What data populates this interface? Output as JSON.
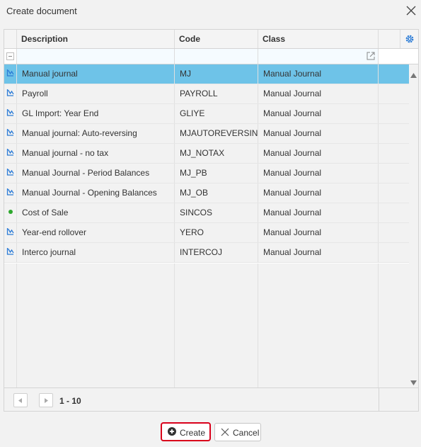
{
  "dialog": {
    "title": "Create document"
  },
  "grid": {
    "columns": [
      "Description",
      "Code",
      "Class"
    ],
    "rows": [
      {
        "icon": "chart-line-icon",
        "description": "Manual journal",
        "code": "MJ",
        "class": "Manual Journal",
        "selected": true
      },
      {
        "icon": "chart-line-icon",
        "description": "Payroll",
        "code": "PAYROLL",
        "class": "Manual Journal"
      },
      {
        "icon": "chart-line-icon",
        "description": "GL Import: Year End",
        "code": "GLIYE",
        "class": "Manual Journal"
      },
      {
        "icon": "chart-line-icon",
        "description": "Manual journal: Auto-reversing",
        "code": "MJAUTOREVERSING",
        "class": "Manual Journal"
      },
      {
        "icon": "chart-line-icon",
        "description": "Manual journal - no tax",
        "code": "MJ_NOTAX",
        "class": "Manual Journal"
      },
      {
        "icon": "chart-line-icon",
        "description": "Manual Journal - Period Balances",
        "code": "MJ_PB",
        "class": "Manual Journal"
      },
      {
        "icon": "chart-line-icon",
        "description": "Manual Journal - Opening Balances",
        "code": "MJ_OB",
        "class": "Manual Journal"
      },
      {
        "icon": "green-dot-icon",
        "description": "Cost of Sale",
        "code": "SINCOS",
        "class": "Manual Journal"
      },
      {
        "icon": "chart-line-icon",
        "description": "Year-end rollover",
        "code": "YERO",
        "class": "Manual Journal"
      },
      {
        "icon": "chart-line-icon",
        "description": "Interco journal",
        "code": "INTERCOJ",
        "class": "Manual Journal"
      }
    ],
    "pager": {
      "info": "1 - 10"
    }
  },
  "buttons": {
    "create": "Create",
    "cancel": "Cancel"
  },
  "colors": {
    "selected_row": "#6ec3e8",
    "accent": "#2b7bd6",
    "create_outline": "#d9001b",
    "green": "#2ea82e"
  }
}
